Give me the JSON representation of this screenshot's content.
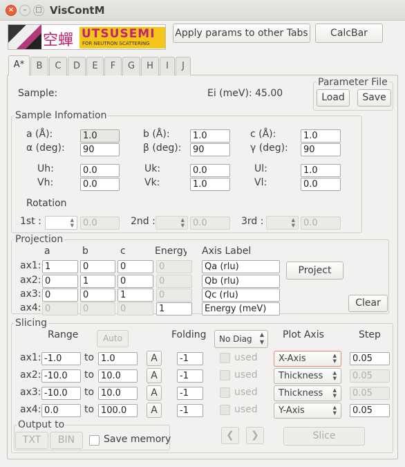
{
  "window": {
    "title": "VisContM",
    "close_glyph": "×",
    "min_glyph": "–",
    "max_glyph": "□"
  },
  "logo": {
    "kanji": "空蟬",
    "name": "UTSUSEMI",
    "tagline": "FOR NEUTRON SCATTERING"
  },
  "toolbar": {
    "apply": "Apply params to other Tabs",
    "calcbar": "CalcBar"
  },
  "tabs": [
    "A*",
    "B",
    "C",
    "D",
    "E",
    "F",
    "G",
    "H",
    "I",
    "J"
  ],
  "sample": {
    "label": "Sample:",
    "ei": "Ei (meV): 45.00"
  },
  "param_file": {
    "title": "Parameter File",
    "load": "Load",
    "save": "Save"
  },
  "info": {
    "title": "Sample Infomation",
    "a_label": "a (Å):",
    "a": "1.0",
    "b_label": "b (Å):",
    "b": "1.0",
    "c_label": "c (Å):",
    "c": "1.0",
    "alpha_label": "α (deg):",
    "alpha": "90",
    "beta_label": "β (deg):",
    "beta": "90",
    "gamma_label": "γ (deg):",
    "gamma": "90",
    "uh_label": "Uh:",
    "uh": "0.0",
    "uk_label": "Uk:",
    "uk": "0.0",
    "ul_label": "Ul:",
    "ul": "1.0",
    "vh_label": "Vh:",
    "vh": "0.0",
    "vk_label": "Vk:",
    "vk": "1.0",
    "vl_label": "Vl:",
    "vl": "0.0",
    "rotation": "Rotation",
    "first": "1st :",
    "second": "2nd :",
    "third": "3rd :",
    "rot1": "0.0",
    "rot2": "0.0",
    "rot3": "0.0"
  },
  "projection": {
    "title": "Projection",
    "headers": {
      "a": "a",
      "b": "b",
      "c": "c",
      "energy": "Energy",
      "axis": "Axis Label"
    },
    "rows": [
      {
        "label": "ax1:",
        "a": "1",
        "b": "0",
        "c": "0",
        "e": "0",
        "axis": "Qa (rlu)"
      },
      {
        "label": "ax2:",
        "a": "0",
        "b": "1",
        "c": "0",
        "e": "0",
        "axis": "Qb (rlu)"
      },
      {
        "label": "ax3:",
        "a": "0",
        "b": "0",
        "c": "1",
        "e": "0",
        "axis": "Qc (rlu)"
      },
      {
        "label": "ax4:",
        "a": "0",
        "b": "0",
        "c": "0",
        "e": "1",
        "axis": "Energy (meV)"
      }
    ],
    "project": "Project",
    "clear": "Clear"
  },
  "slicing": {
    "title": "Slicing",
    "headers": {
      "range": "Range",
      "auto": "Auto",
      "folding": "Folding",
      "diag": "No Diag",
      "plot_axis": "Plot Axis",
      "step": "Step"
    },
    "to": "to",
    "a_btn": "A",
    "used": "used",
    "rows": [
      {
        "label": "ax1:",
        "from": "-1.0",
        "to": "1.0",
        "fold": "-1",
        "axis": "X-Axis",
        "step": "0.05"
      },
      {
        "label": "ax2:",
        "from": "-10.0",
        "to": "10.0",
        "fold": "-1",
        "axis": "Thickness",
        "step": "0.05"
      },
      {
        "label": "ax3:",
        "from": "-10.0",
        "to": "10.0",
        "fold": "-1",
        "axis": "Thickness",
        "step": "0.05"
      },
      {
        "label": "ax4:",
        "from": "0.0",
        "to": "100.0",
        "fold": "-1",
        "axis": "Y-Axis",
        "step": "0.05"
      }
    ],
    "output": "Output to",
    "txt": "TXT",
    "bin": "BIN",
    "save_memory": "Save memory",
    "prev": "❮",
    "next": "❯",
    "slice": "Slice"
  }
}
